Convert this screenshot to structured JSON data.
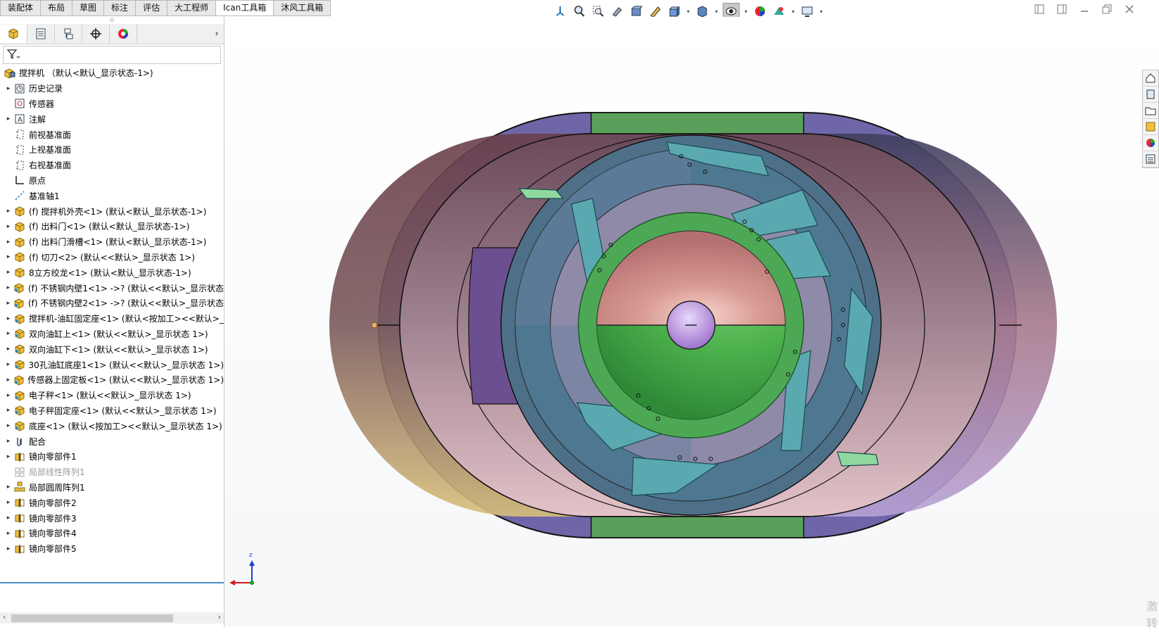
{
  "command_tabs": [
    {
      "label": "装配体"
    },
    {
      "label": "布局"
    },
    {
      "label": "草图"
    },
    {
      "label": "标注"
    },
    {
      "label": "评估"
    },
    {
      "label": "大工程师"
    },
    {
      "label": "Ican工具箱",
      "active": true
    },
    {
      "label": "沐风工具箱"
    }
  ],
  "view_toolbar_icons": [
    "view-orientation-icon",
    "zoom-to-fit-icon",
    "zoom-to-area-icon",
    "previous-view-icon",
    "section-view-icon",
    "dynamic-annotation-icon",
    "view-orientation-cube-icon",
    "display-style-icon",
    "hide-show-items-icon",
    "edit-appearance-icon",
    "apply-scene-icon",
    "view-settings-icon"
  ],
  "tree": {
    "root": "搅拌机 （默认<默认_显示状态-1>)",
    "items": [
      {
        "label": "历史记录",
        "icon": "history-icon",
        "expand": true
      },
      {
        "label": "传感器",
        "icon": "sensor-icon",
        "expand": false
      },
      {
        "label": "注解",
        "icon": "annotation-icon",
        "expand": true
      },
      {
        "label": "前视基准面",
        "icon": "plane-icon",
        "expand": false
      },
      {
        "label": "上视基准面",
        "icon": "plane-icon",
        "expand": false
      },
      {
        "label": "右视基准面",
        "icon": "plane-icon",
        "expand": false
      },
      {
        "label": "原点",
        "icon": "origin-icon",
        "expand": false
      },
      {
        "label": "基准轴1",
        "icon": "axis-icon",
        "expand": false
      },
      {
        "label": "(f) 搅拌机外壳<1> (默认<默认_显示状态-1>)",
        "icon": "part-icon",
        "expand": true
      },
      {
        "label": "(f) 出料门<1> (默认<默认_显示状态-1>)",
        "icon": "part-icon",
        "expand": true
      },
      {
        "label": "(f) 出料门滑槽<1> (默认<默认_显示状态-1>)",
        "icon": "part-icon",
        "expand": true
      },
      {
        "label": "(f) 切刀<2> (默认<<默认>_显示状态 1>)",
        "icon": "part-icon",
        "expand": true
      },
      {
        "label": "8立方绞龙<1> (默认<默认_显示状态-1>)",
        "icon": "part-icon",
        "expand": true
      },
      {
        "label": "(f) 不锈钢内壁1<1> ->? (默认<<默认>_显示状态",
        "icon": "part-warn-icon",
        "expand": true
      },
      {
        "label": "(f) 不锈钢内壁2<1> ->? (默认<<默认>_显示状态",
        "icon": "part-warn-icon",
        "expand": true
      },
      {
        "label": "搅拌机-油缸固定座<1> (默认<按加工><<默认>_",
        "icon": "part-warn-icon",
        "expand": true
      },
      {
        "label": "双向油缸上<1> (默认<<默认>_显示状态 1>)",
        "icon": "part-warn-icon",
        "expand": true
      },
      {
        "label": "双向油缸下<1> (默认<<默认>_显示状态 1>)",
        "icon": "part-warn-icon",
        "expand": true
      },
      {
        "label": "30孔油缸底座1<1> (默认<<默认>_显示状态 1>)",
        "icon": "part-warn-icon",
        "expand": true
      },
      {
        "label": "传感器上固定板<1> (默认<<默认>_显示状态 1>)",
        "icon": "part-warn-icon",
        "expand": true
      },
      {
        "label": "电子秤<1> (默认<<默认>_显示状态 1>)",
        "icon": "part-warn-icon",
        "expand": true
      },
      {
        "label": "电子秤固定座<1> (默认<<默认>_显示状态 1>)",
        "icon": "part-warn-icon",
        "expand": true
      },
      {
        "label": "底座<1> (默认<按加工><<默认>_显示状态 1>)",
        "icon": "part-warn-icon",
        "expand": true
      },
      {
        "label": "配合",
        "icon": "mates-icon",
        "expand": true
      },
      {
        "label": "镜向零部件1",
        "icon": "mirror-icon",
        "expand": true
      },
      {
        "label": "局部线性阵列1",
        "icon": "linear-pattern-icon",
        "expand": false,
        "gray": true
      },
      {
        "label": "局部圆周阵列1",
        "icon": "circular-pattern-icon",
        "expand": true
      },
      {
        "label": "镜向零部件2",
        "icon": "mirror-icon",
        "expand": true
      },
      {
        "label": "镜向零部件3",
        "icon": "mirror-icon",
        "expand": true
      },
      {
        "label": "镜向零部件4",
        "icon": "mirror-icon",
        "expand": true
      },
      {
        "label": "镜向零部件5",
        "icon": "mirror-icon",
        "expand": true
      }
    ]
  },
  "triad": {
    "z": "z"
  },
  "watermark": [
    "激",
    "转"
  ]
}
